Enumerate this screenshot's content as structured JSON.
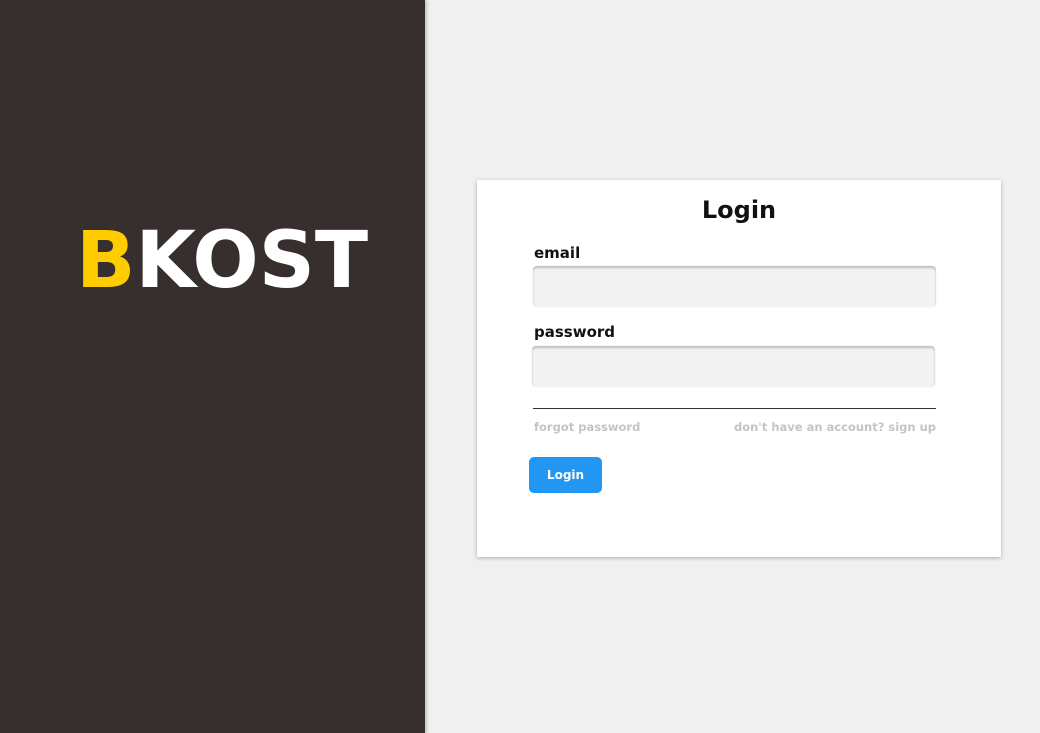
{
  "brand": {
    "logo_first_letter": "B",
    "logo_rest": "KOST",
    "accent_color": "#ffcc00",
    "panel_color": "#372e2e"
  },
  "login_form": {
    "title": "Login",
    "email_label": "email",
    "email_value": "",
    "password_label": "password",
    "password_value": "",
    "forgot_password_link": "forgot password",
    "signup_link": "don't have an account? sign up",
    "submit_label": "Login",
    "submit_color": "#2196f3"
  }
}
